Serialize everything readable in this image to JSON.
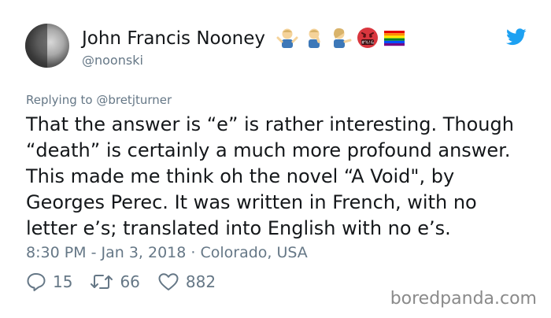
{
  "user": {
    "name": "John Francis Nooney",
    "handle": "@noonski"
  },
  "icons": {
    "twitter": "twitter-bird-icon",
    "reply": "reply-bubble-icon",
    "retweet": "retweet-icon",
    "like": "heart-icon"
  },
  "emojis": [
    "person-shrugging-icon",
    "person-facepalming-icon",
    "person-tipping-hand-icon",
    "face-with-symbols-on-mouth-icon",
    "rainbow-flag-icon"
  ],
  "reply_context": {
    "prefix": "Replying to ",
    "handle": "@bretjturner"
  },
  "tweet": {
    "text": "That the answer is “e” is rather interesting. Though “death” is certainly a much more profound answer. This made me think oh the novel “A Void\", by Georges Perec. It was written in French, with no letter e’s; translated into English with no e’s."
  },
  "meta": {
    "timestamp": "8:30 PM - Jan 3, 2018 · Colorado, USA"
  },
  "stats": {
    "replies": "15",
    "retweets": "66",
    "likes": "882"
  },
  "watermark": "boredpanda.com",
  "colors": {
    "text": "#14171a",
    "secondary": "#657786",
    "twitter_blue": "#1da1f2"
  }
}
